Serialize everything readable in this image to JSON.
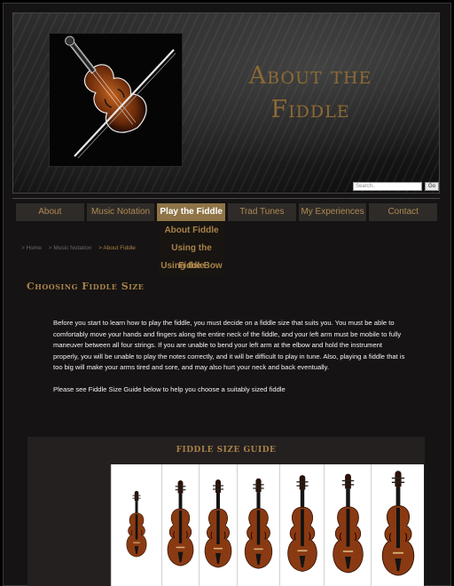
{
  "header": {
    "title_line1": "About the",
    "title_line2": "Fiddle",
    "search_placeholder": "Search..",
    "search_button": "Go"
  },
  "nav": {
    "items": [
      {
        "label": "About",
        "active": false
      },
      {
        "label": "Music Notation",
        "active": false
      },
      {
        "label": "Play the Fiddle",
        "active": true
      },
      {
        "label": "Trad Tunes",
        "active": false
      },
      {
        "label": "My Experiences",
        "active": false
      },
      {
        "label": "Contact",
        "active": false
      }
    ],
    "dropdown": [
      "About Fiddle",
      "Using the Fiddle",
      "Using the Bow"
    ]
  },
  "breadcrumb": [
    {
      "label": "> Home"
    },
    {
      "label": "> Music Notation"
    },
    {
      "label": "> About Fiddle"
    }
  ],
  "main": {
    "heading": "Choosing Fiddle Size",
    "paragraph1": "Before you start to learn how to play the fiddle, you must decide on a fiddle size that suits you. You must be able to comfortably move your hands and fingers along the entire neck of the fiddle, and your left arm must be mobile to fully maneuver between all four strings. If you are unable to bend your left arm at the elbow and hold the instrument properly, you will be unable to play the notes correctly, and it will be difficult to play in tune. Also, playing a fiddle that is too big will make your arms tired and sore, and may also hurt your neck and back eventually.",
    "paragraph2": "Please see Fiddle Size Guide below to help you choose a suitably sized fiddle"
  },
  "guide": {
    "title": "FIDDLE SIZE GUIDE",
    "fiddles": [
      {
        "icon": "violin-icon",
        "scale": 0.62
      },
      {
        "icon": "violin-icon",
        "scale": 0.8
      },
      {
        "icon": "violin-icon",
        "scale": 0.82
      },
      {
        "icon": "violin-icon",
        "scale": 0.85
      },
      {
        "icon": "violin-icon",
        "scale": 0.9
      },
      {
        "icon": "violin-icon",
        "scale": 0.93
      },
      {
        "icon": "violin-icon",
        "scale": 0.98
      }
    ]
  },
  "colors": {
    "accent_gold": "#a88248",
    "nav_active": "#8e7446",
    "nav_bg": "#2e2b28",
    "violin_body": "#8a3a12"
  }
}
